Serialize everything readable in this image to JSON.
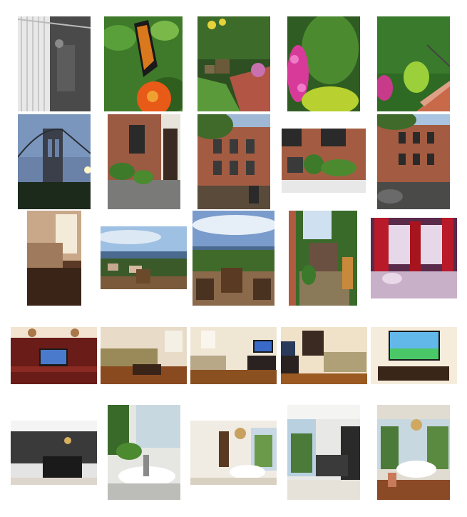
{
  "gallery": {
    "rows": [
      {
        "row": 1,
        "photos": [
          {
            "subject": "shower-curtain-bathroom"
          },
          {
            "subject": "monarch-butterfly-on-orange-flower"
          },
          {
            "subject": "garden-patio-with-chairs"
          },
          {
            "subject": "pink-flowers-and-hedge"
          },
          {
            "subject": "ivy-wall-and-steps"
          }
        ]
      },
      {
        "row": 2,
        "photos": [
          {
            "subject": "brooklyn-bridge-at-dusk"
          },
          {
            "subject": "brick-entrance-with-plants"
          },
          {
            "subject": "brownstone-front-facade"
          },
          {
            "subject": "window-and-potted-plants"
          },
          {
            "subject": "brownstone-street-view"
          }
        ]
      },
      {
        "row": 3,
        "photos": [
          {
            "subject": "bedroom-with-window"
          },
          {
            "subject": "harbor-view-terrace"
          },
          {
            "subject": "terrace-deck-with-chairs"
          },
          {
            "subject": "garden-gate-and-path"
          },
          {
            "subject": "bedroom-with-red-curtains"
          }
        ]
      },
      {
        "row": 4,
        "photos": [
          {
            "subject": "wooden-desk-with-computer"
          },
          {
            "subject": "living-room-sofa"
          },
          {
            "subject": "living-room-with-tv"
          },
          {
            "subject": "living-room-wide"
          },
          {
            "subject": "tv-on-wall-console"
          }
        ]
      },
      {
        "row": 5,
        "photos": [
          {
            "subject": "modern-kitchen-island"
          },
          {
            "subject": "bathroom-sink-with-plant"
          },
          {
            "subject": "bright-bathroom-with-tub"
          },
          {
            "subject": "sunroom-kitchen"
          },
          {
            "subject": "clawfoot-tub-with-chandelier"
          }
        ]
      }
    ]
  }
}
